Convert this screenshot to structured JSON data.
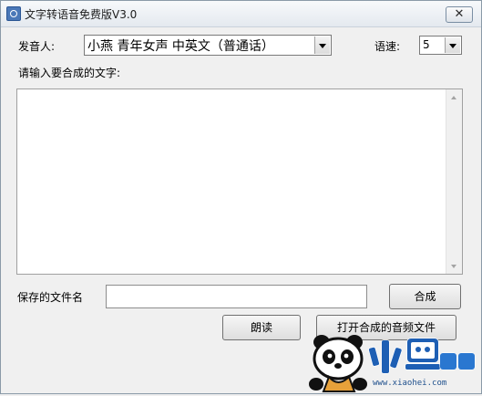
{
  "window": {
    "title": "文字转语音免费版V3.0",
    "close_glyph": "✕"
  },
  "voice": {
    "label": "发音人:",
    "selected": "小燕  青年女声  中英文（普通话）"
  },
  "speed": {
    "label": "语速:",
    "selected": "5"
  },
  "input_text": {
    "label": "请输入要合成的文字:",
    "value": ""
  },
  "save": {
    "label": "保存的文件名",
    "value": ""
  },
  "buttons": {
    "synthesize": "合成",
    "read": "朗读",
    "open_audio": "打开合成的音频文件"
  },
  "watermark": {
    "brand_text": "小黑游戏",
    "site": "www.xiaohei.com"
  },
  "colors": {
    "brand_blue": "#1e5fb4",
    "panda_black": "#111111"
  }
}
